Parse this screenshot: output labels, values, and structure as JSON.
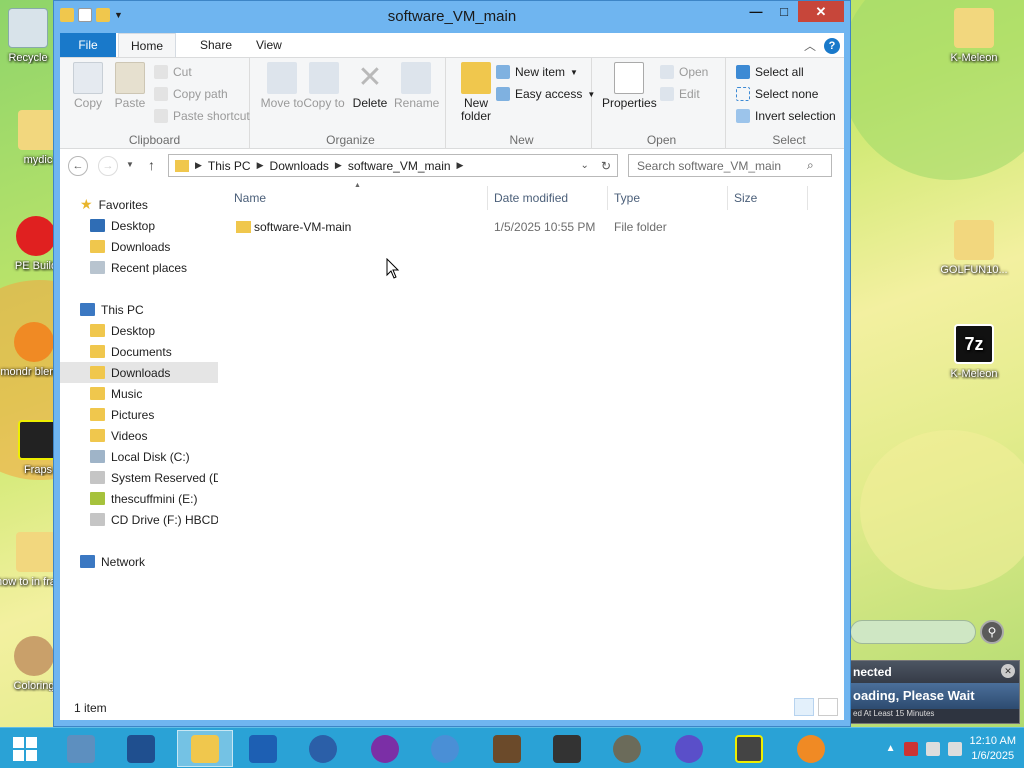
{
  "window": {
    "title": "software_VM_main",
    "buttons": {
      "minimize": "—",
      "maximize": "□",
      "close": "✕"
    }
  },
  "ribbon": {
    "tabs": [
      "File",
      "Home",
      "Share",
      "View"
    ],
    "help": "?",
    "groups": {
      "clipboard": {
        "label": "Clipboard",
        "copy": "Copy",
        "paste": "Paste",
        "cut": "Cut",
        "copy_path": "Copy path",
        "paste_shortcut": "Paste shortcut"
      },
      "organize": {
        "label": "Organize",
        "move_to": "Move to",
        "copy_to": "Copy to",
        "delete": "Delete",
        "rename": "Rename"
      },
      "new": {
        "label": "New",
        "new_folder": "New folder",
        "new_item": "New item",
        "easy_access": "Easy access"
      },
      "open": {
        "label": "Open",
        "properties": "Properties",
        "open": "Open",
        "edit": "Edit"
      },
      "select": {
        "label": "Select",
        "select_all": "Select all",
        "select_none": "Select none",
        "invert_selection": "Invert selection"
      }
    }
  },
  "address": {
    "crumbs": [
      "This PC",
      "Downloads",
      "software_VM_main"
    ],
    "search_placeholder": "Search software_VM_main"
  },
  "navpane": {
    "favorites": "Favorites",
    "fav_items": [
      "Desktop",
      "Downloads",
      "Recent places"
    ],
    "this_pc": "This PC",
    "pc_items": [
      "Desktop",
      "Documents",
      "Downloads",
      "Music",
      "Pictures",
      "Videos",
      "Local Disk (C:)",
      "System Reserved (D:",
      "thescuffmini (E:)",
      "CD Drive (F:) HBCD_"
    ],
    "network": "Network"
  },
  "columns": {
    "name": "Name",
    "date": "Date modified",
    "type": "Type",
    "size": "Size"
  },
  "files": [
    {
      "name": "software-VM-main",
      "date": "1/5/2025 10:55 PM",
      "type": "File folder",
      "size": ""
    }
  ],
  "status": "1 item",
  "desktop_icons": [
    "Recycle",
    "mydic",
    "PE Build",
    "mondr blende",
    "Fraps",
    "how to in fraps.z",
    "Coloring",
    "K-Meleon",
    "GOLFUN10...",
    "K-Meleon"
  ],
  "widget": {
    "header": "nected",
    "body": "oading, Please Wait",
    "sub": "ed At Least 15 Minutes"
  },
  "clock": {
    "time": "12:10 AM",
    "date": "1/6/2025"
  },
  "colors": {
    "accent": "#1979ca",
    "titlebar": "#6fb5f0",
    "taskbar": "#2aa2d6"
  }
}
